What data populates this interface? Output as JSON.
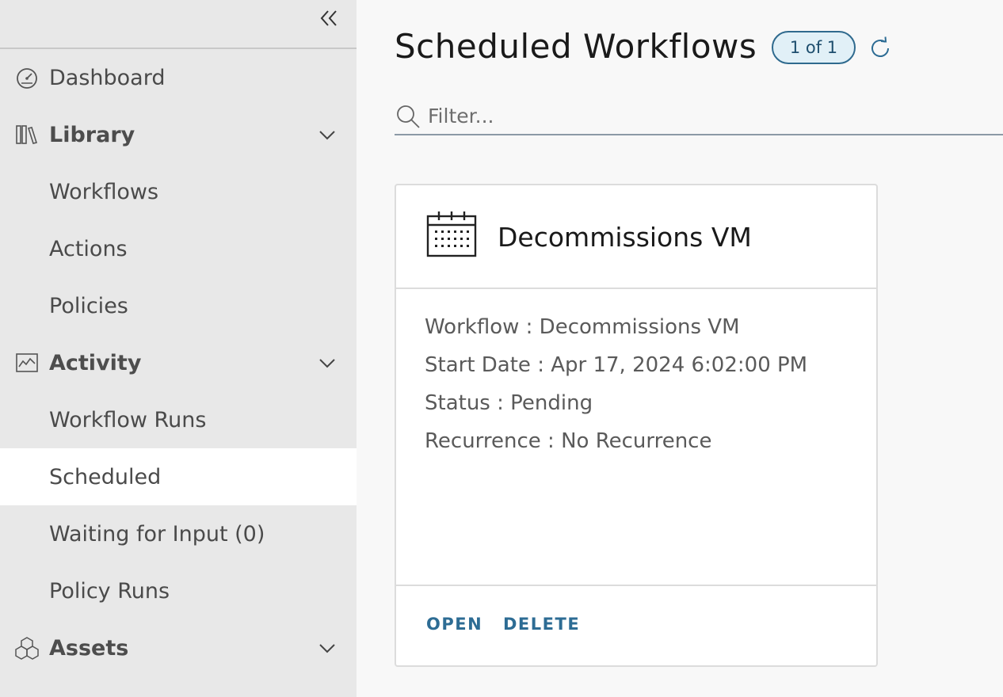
{
  "sidebar": {
    "collapse_icon": "double-chevron-left-icon",
    "items": [
      {
        "label": "Dashboard",
        "icon": "dashboard-gauge-icon"
      },
      {
        "label": "Library",
        "icon": "library-books-icon"
      },
      {
        "label": "Workflows"
      },
      {
        "label": "Actions"
      },
      {
        "label": "Policies"
      },
      {
        "label": "Activity",
        "icon": "activity-chart-icon"
      },
      {
        "label": "Workflow Runs"
      },
      {
        "label": "Scheduled"
      },
      {
        "label": "Waiting for Input (0)"
      },
      {
        "label": "Policy Runs"
      },
      {
        "label": "Assets",
        "icon": "assets-cubes-icon"
      }
    ],
    "active_item": "Scheduled"
  },
  "main": {
    "title": "Scheduled Workflows",
    "count_badge": "1 of 1",
    "filter_placeholder": "Filter...",
    "card": {
      "title": "Decommissions VM",
      "lines": [
        "Workflow : Decommissions VM",
        "Start Date : Apr 17, 2024 6:02:00 PM",
        "Status : Pending",
        "Recurrence : No Recurrence"
      ],
      "open_label": "OPEN",
      "delete_label": "DELETE"
    }
  },
  "colors": {
    "sidebar_bg": "#e8e8e8",
    "active_bg": "#ffffff",
    "accent": "#2d6c94",
    "badge_bg": "#e1f0f7"
  }
}
